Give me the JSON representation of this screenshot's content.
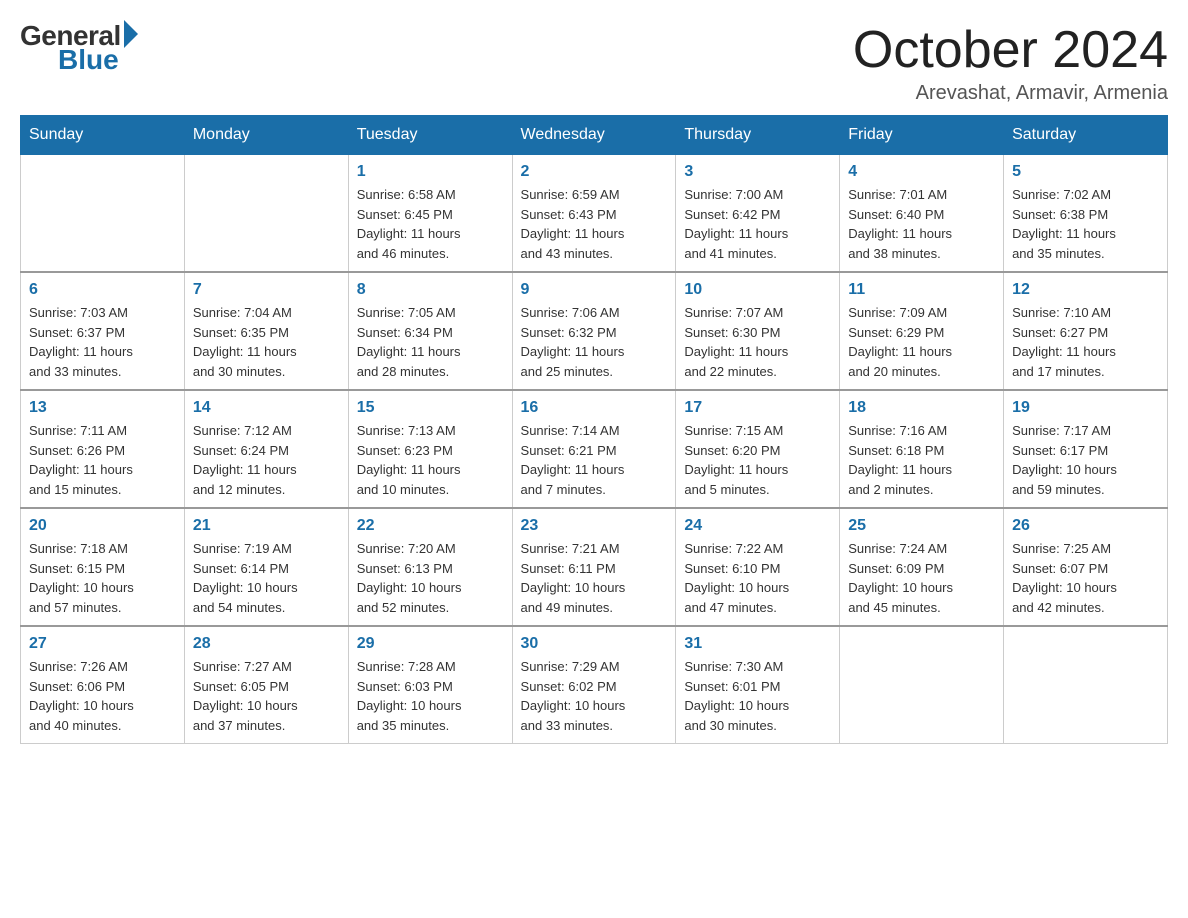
{
  "logo": {
    "general": "General",
    "blue": "Blue"
  },
  "title": "October 2024",
  "location": "Arevashat, Armavir, Armenia",
  "headers": [
    "Sunday",
    "Monday",
    "Tuesday",
    "Wednesday",
    "Thursday",
    "Friday",
    "Saturday"
  ],
  "weeks": [
    [
      {
        "day": "",
        "info": ""
      },
      {
        "day": "",
        "info": ""
      },
      {
        "day": "1",
        "info": "Sunrise: 6:58 AM\nSunset: 6:45 PM\nDaylight: 11 hours\nand 46 minutes."
      },
      {
        "day": "2",
        "info": "Sunrise: 6:59 AM\nSunset: 6:43 PM\nDaylight: 11 hours\nand 43 minutes."
      },
      {
        "day": "3",
        "info": "Sunrise: 7:00 AM\nSunset: 6:42 PM\nDaylight: 11 hours\nand 41 minutes."
      },
      {
        "day": "4",
        "info": "Sunrise: 7:01 AM\nSunset: 6:40 PM\nDaylight: 11 hours\nand 38 minutes."
      },
      {
        "day": "5",
        "info": "Sunrise: 7:02 AM\nSunset: 6:38 PM\nDaylight: 11 hours\nand 35 minutes."
      }
    ],
    [
      {
        "day": "6",
        "info": "Sunrise: 7:03 AM\nSunset: 6:37 PM\nDaylight: 11 hours\nand 33 minutes."
      },
      {
        "day": "7",
        "info": "Sunrise: 7:04 AM\nSunset: 6:35 PM\nDaylight: 11 hours\nand 30 minutes."
      },
      {
        "day": "8",
        "info": "Sunrise: 7:05 AM\nSunset: 6:34 PM\nDaylight: 11 hours\nand 28 minutes."
      },
      {
        "day": "9",
        "info": "Sunrise: 7:06 AM\nSunset: 6:32 PM\nDaylight: 11 hours\nand 25 minutes."
      },
      {
        "day": "10",
        "info": "Sunrise: 7:07 AM\nSunset: 6:30 PM\nDaylight: 11 hours\nand 22 minutes."
      },
      {
        "day": "11",
        "info": "Sunrise: 7:09 AM\nSunset: 6:29 PM\nDaylight: 11 hours\nand 20 minutes."
      },
      {
        "day": "12",
        "info": "Sunrise: 7:10 AM\nSunset: 6:27 PM\nDaylight: 11 hours\nand 17 minutes."
      }
    ],
    [
      {
        "day": "13",
        "info": "Sunrise: 7:11 AM\nSunset: 6:26 PM\nDaylight: 11 hours\nand 15 minutes."
      },
      {
        "day": "14",
        "info": "Sunrise: 7:12 AM\nSunset: 6:24 PM\nDaylight: 11 hours\nand 12 minutes."
      },
      {
        "day": "15",
        "info": "Sunrise: 7:13 AM\nSunset: 6:23 PM\nDaylight: 11 hours\nand 10 minutes."
      },
      {
        "day": "16",
        "info": "Sunrise: 7:14 AM\nSunset: 6:21 PM\nDaylight: 11 hours\nand 7 minutes."
      },
      {
        "day": "17",
        "info": "Sunrise: 7:15 AM\nSunset: 6:20 PM\nDaylight: 11 hours\nand 5 minutes."
      },
      {
        "day": "18",
        "info": "Sunrise: 7:16 AM\nSunset: 6:18 PM\nDaylight: 11 hours\nand 2 minutes."
      },
      {
        "day": "19",
        "info": "Sunrise: 7:17 AM\nSunset: 6:17 PM\nDaylight: 10 hours\nand 59 minutes."
      }
    ],
    [
      {
        "day": "20",
        "info": "Sunrise: 7:18 AM\nSunset: 6:15 PM\nDaylight: 10 hours\nand 57 minutes."
      },
      {
        "day": "21",
        "info": "Sunrise: 7:19 AM\nSunset: 6:14 PM\nDaylight: 10 hours\nand 54 minutes."
      },
      {
        "day": "22",
        "info": "Sunrise: 7:20 AM\nSunset: 6:13 PM\nDaylight: 10 hours\nand 52 minutes."
      },
      {
        "day": "23",
        "info": "Sunrise: 7:21 AM\nSunset: 6:11 PM\nDaylight: 10 hours\nand 49 minutes."
      },
      {
        "day": "24",
        "info": "Sunrise: 7:22 AM\nSunset: 6:10 PM\nDaylight: 10 hours\nand 47 minutes."
      },
      {
        "day": "25",
        "info": "Sunrise: 7:24 AM\nSunset: 6:09 PM\nDaylight: 10 hours\nand 45 minutes."
      },
      {
        "day": "26",
        "info": "Sunrise: 7:25 AM\nSunset: 6:07 PM\nDaylight: 10 hours\nand 42 minutes."
      }
    ],
    [
      {
        "day": "27",
        "info": "Sunrise: 7:26 AM\nSunset: 6:06 PM\nDaylight: 10 hours\nand 40 minutes."
      },
      {
        "day": "28",
        "info": "Sunrise: 7:27 AM\nSunset: 6:05 PM\nDaylight: 10 hours\nand 37 minutes."
      },
      {
        "day": "29",
        "info": "Sunrise: 7:28 AM\nSunset: 6:03 PM\nDaylight: 10 hours\nand 35 minutes."
      },
      {
        "day": "30",
        "info": "Sunrise: 7:29 AM\nSunset: 6:02 PM\nDaylight: 10 hours\nand 33 minutes."
      },
      {
        "day": "31",
        "info": "Sunrise: 7:30 AM\nSunset: 6:01 PM\nDaylight: 10 hours\nand 30 minutes."
      },
      {
        "day": "",
        "info": ""
      },
      {
        "day": "",
        "info": ""
      }
    ]
  ]
}
